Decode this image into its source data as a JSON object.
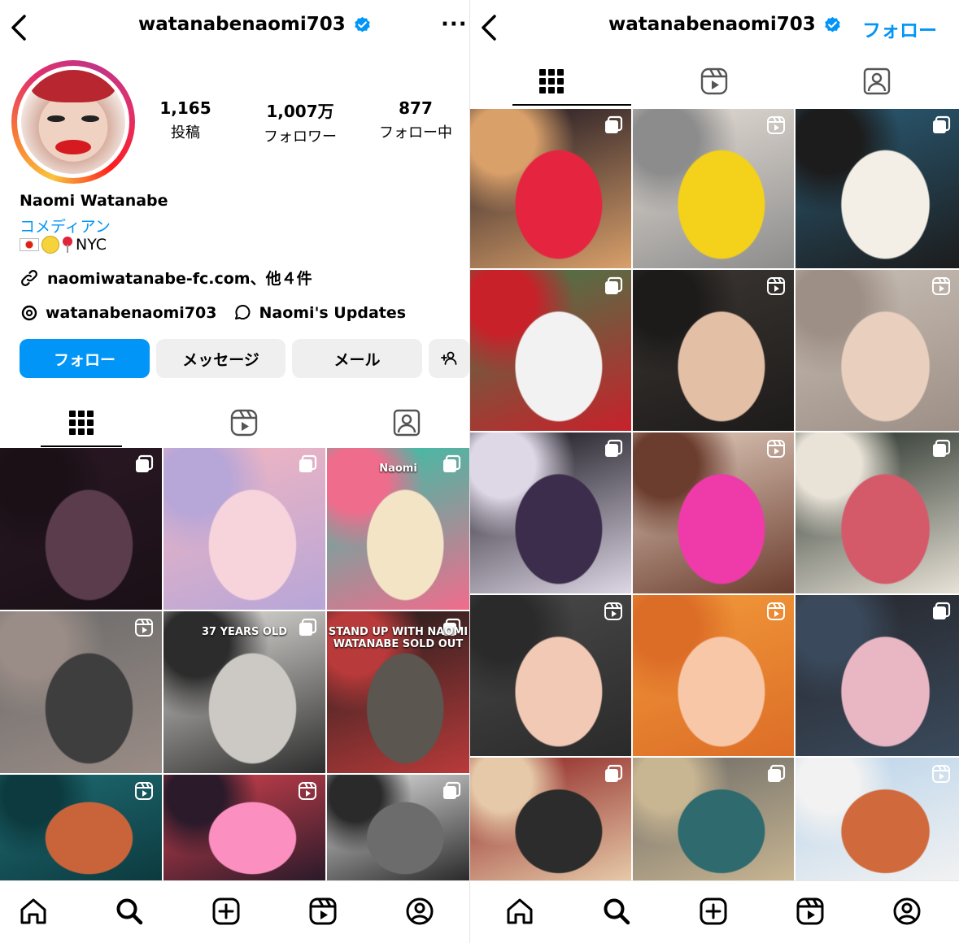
{
  "colors": {
    "accent": "#0095f6",
    "verified": "#0095f6",
    "button_secondary": "#efefef",
    "ring_gradient": [
      "#f9c33d",
      "#f77737",
      "#e1306c",
      "#c13584"
    ]
  },
  "left": {
    "header": {
      "username": "watanabenaomi703",
      "back_icon": "chevron-left-icon",
      "more_icon": "more-dots-icon",
      "more_label": "···"
    },
    "profile": {
      "avatar_icon": "profile-avatar",
      "stats": [
        {
          "value": "1,165",
          "label": "投稿"
        },
        {
          "value": "1,007万",
          "label": "フォロワー"
        },
        {
          "value": "877",
          "label": "フォロー中"
        }
      ],
      "name": "Naomi Watanabe",
      "category": "コメディアン",
      "location_text": "NYC",
      "link_text": "naomiwatanabe-fc.com、他４件",
      "threads_handle": "watanabenaomi703",
      "updates_text": "Naomi's Updates"
    },
    "buttons": {
      "follow": "フォロー",
      "message": "メッセージ",
      "mail": "メール",
      "suggest_icon": "add-person-icon"
    },
    "tabs": [
      "grid-icon",
      "reels-icon",
      "tagged-icon"
    ],
    "grid": {
      "posts": [
        {
          "type": "carousel",
          "colors": [
            "#2a1824",
            "#5a3c4c",
            "#1a1016"
          ]
        },
        {
          "type": "carousel",
          "colors": [
            "#f4b6c0",
            "#f7d4dc",
            "#b7a6d8"
          ],
          "top_text": ""
        },
        {
          "type": "carousel",
          "colors": [
            "#2cc5a8",
            "#f3e4c6",
            "#f06c8c"
          ],
          "top_text": "Naomi"
        },
        {
          "type": "reel",
          "colors": [
            "#6a6a6a",
            "#3e3e3e",
            "#9a8c86"
          ]
        },
        {
          "type": "carousel",
          "colors": [
            "#e7e5e1",
            "#ccc9c4",
            "#2c2c2c"
          ],
          "top_text": "37 YEARS OLD"
        },
        {
          "type": "carousel",
          "colors": [
            "#1c1c1c",
            "#5b5650",
            "#b93a3a"
          ],
          "top_text": "STAND UP WITH NAOMI WATANABE SOLD OUT"
        },
        {
          "type": "reel",
          "colors": [
            "#1f6c74",
            "#c9643a",
            "#0c3a3e"
          ]
        },
        {
          "type": "reel",
          "colors": [
            "#d7424e",
            "#fb8fbf",
            "#2a1a2a"
          ]
        },
        {
          "type": "carousel",
          "colors": [
            "#e5e5e5",
            "#6c6c6c",
            "#2a2a2a"
          ]
        }
      ]
    }
  },
  "right": {
    "header": {
      "username": "watanabenaomi703",
      "back_icon": "chevron-left-icon",
      "follow_link": "フォロー"
    },
    "tabs": [
      "grid-icon",
      "reels-icon",
      "tagged-icon"
    ],
    "grid": {
      "posts": [
        {
          "type": "carousel",
          "colors": [
            "#1a1420",
            "#e52440",
            "#d9a06a"
          ]
        },
        {
          "type": "reel",
          "colors": [
            "#e6ded6",
            "#f4d11a",
            "#8c8c8c"
          ]
        },
        {
          "type": "carousel",
          "colors": [
            "#2a5d78",
            "#f3efe6",
            "#1c1c1c"
          ]
        },
        {
          "type": "carousel",
          "colors": [
            "#3f7d4a",
            "#f2f2f2",
            "#c8212a"
          ]
        },
        {
          "type": "reel",
          "colors": [
            "#3b3633",
            "#e2bfa5",
            "#1d1b1a"
          ]
        },
        {
          "type": "reel",
          "colors": [
            "#c9bfb6",
            "#e8cfbe",
            "#9d8f86"
          ]
        },
        {
          "type": "carousel",
          "colors": [
            "#0e0c14",
            "#3b2d4b",
            "#ded7e6"
          ]
        },
        {
          "type": "reel",
          "colors": [
            "#e3cfc0",
            "#ef3aa9",
            "#6b3d2e"
          ]
        },
        {
          "type": "carousel",
          "colors": [
            "#1f2a22",
            "#d45a6a",
            "#e8e2d7"
          ]
        },
        {
          "type": "reel",
          "colors": [
            "#4a4a4a",
            "#f2c9b4",
            "#2a2a2a"
          ]
        },
        {
          "type": "reel",
          "colors": [
            "#f29a3a",
            "#f7c7a8",
            "#dc6d27"
          ]
        },
        {
          "type": "carousel",
          "colors": [
            "#26262b",
            "#e9b7c4",
            "#3a4a5c"
          ]
        },
        {
          "type": "carousel",
          "colors": [
            "#8b1e1e",
            "#2c2c2c",
            "#e6c9a8"
          ]
        },
        {
          "type": "carousel",
          "colors": [
            "#6b6a66",
            "#2e6a6e",
            "#c8b592"
          ]
        },
        {
          "type": "reel",
          "colors": [
            "#b8d3ea",
            "#d06a3c",
            "#f2f2f2"
          ]
        }
      ]
    }
  },
  "bottom_nav": [
    "home-icon",
    "search-icon",
    "create-icon",
    "reels-icon",
    "profile-icon"
  ]
}
